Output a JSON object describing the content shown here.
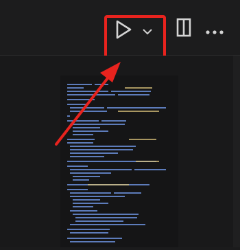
{
  "toolbar": {
    "run_button": {
      "icon": "play-icon"
    },
    "run_dropdown": {
      "icon": "chevron-down-icon"
    },
    "split_editor_button": {
      "icon": "split-editor-icon"
    },
    "more_actions_button": {
      "icon": "ellipsis-icon"
    }
  },
  "highlight": {
    "color": "#e8231e"
  },
  "colors": {
    "background": "#1b1b1c",
    "icon": "#d4d4d4",
    "accent_red": "#e8231e"
  }
}
